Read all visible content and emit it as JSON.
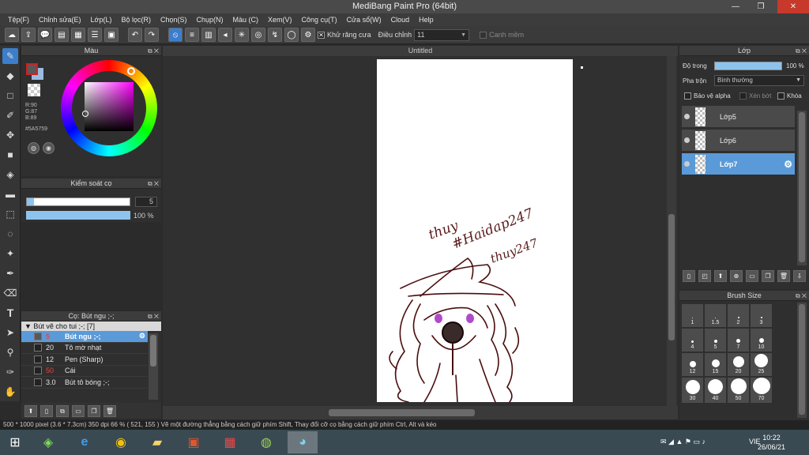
{
  "window": {
    "title": "MediBang Paint Pro (64bit)",
    "min": "—",
    "max": "❐",
    "close": "✕"
  },
  "menu": [
    "Tệp(F)",
    "Chỉnh sửa(E)",
    "Lớp(L)",
    "Bộ lọc(R)",
    "Chọn(S)",
    "Chụp(N)",
    "Màu (C)",
    "Xem(V)",
    "Công cụ(T)",
    "Cửa sổ(W)",
    "Cloud",
    "Help"
  ],
  "toolbar": {
    "antialias_label": "Khử răng cưa",
    "correction_label": "Điều chỉnh",
    "correction_value": "11",
    "overlay_label": "Canh mềm"
  },
  "color_panel": {
    "title": "Màu",
    "r": "R:90",
    "g": "G:87",
    "b": "B:89",
    "hex": "#5A5759",
    "fg_color": "#5A5759"
  },
  "brush_control": {
    "title": "Kiểm soát cọ",
    "size": "5",
    "opacity": "100 %"
  },
  "brush_list": {
    "title": "Cọ: Bút ngu ;-;",
    "group": "Bút vẽ cho tui ;-; [7]",
    "items": [
      {
        "size": "5",
        "name": "Bút ngu ;-;"
      },
      {
        "size": "20",
        "name": "Tô mờ nhạt"
      },
      {
        "size": "12",
        "name": "Pen (Sharp)"
      },
      {
        "size": "50",
        "name": "Cái"
      },
      {
        "size": "3.0",
        "name": "Bút tô bóng ;-;"
      }
    ]
  },
  "canvas": {
    "tab": "Untitled",
    "text_1": "thuy",
    "text_2": "#Haidap247",
    "text_3": "thuy247"
  },
  "layer_panel": {
    "title": "Lớp",
    "opacity_label": "Độ trong",
    "opacity_value": "100 %",
    "blend_label": "Pha trộn",
    "blend_value": "Bình thường",
    "protect_alpha": "Bảo vệ alpha",
    "clipping": "Xén bớt",
    "lock": "Khóa",
    "layers": [
      {
        "name": "Lớp5"
      },
      {
        "name": "Lớp6"
      },
      {
        "name": "Lớp7"
      }
    ]
  },
  "brush_size": {
    "title": "Brush Size",
    "sizes": [
      "1",
      "1.5",
      "2",
      "3",
      "4",
      "5",
      "7",
      "10",
      "12",
      "15",
      "20",
      "25",
      "30",
      "40",
      "50",
      "70"
    ]
  },
  "status": "500 * 1000 pixel  (3.6 * 7.3cm)  350 dpi  66 %  ( 521, 155 )  Vẽ một đường thẳng bằng cách giữ phím Shift, Thay đổi cỡ cọ bằng cách giữ phím Ctrl, Alt và kéo",
  "taskbar": {
    "lang": "VIE",
    "time": "10:22",
    "date": "26/06/21"
  }
}
